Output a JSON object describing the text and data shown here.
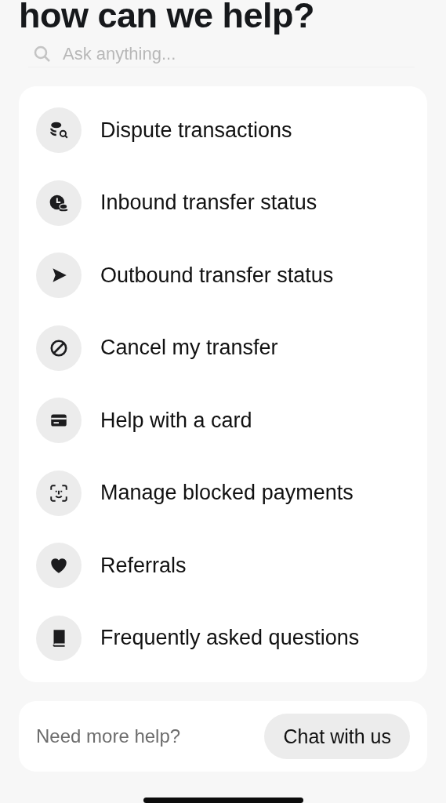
{
  "title": "how can we help?",
  "search": {
    "placeholder": "Ask anything..."
  },
  "topics": [
    {
      "label": "Dispute transactions"
    },
    {
      "label": "Inbound transfer status"
    },
    {
      "label": "Outbound transfer status"
    },
    {
      "label": "Cancel my transfer"
    },
    {
      "label": "Help with a card"
    },
    {
      "label": "Manage blocked payments"
    },
    {
      "label": "Referrals"
    },
    {
      "label": "Frequently asked questions"
    }
  ],
  "footer": {
    "text": "Need more help?",
    "button": "Chat with us"
  }
}
